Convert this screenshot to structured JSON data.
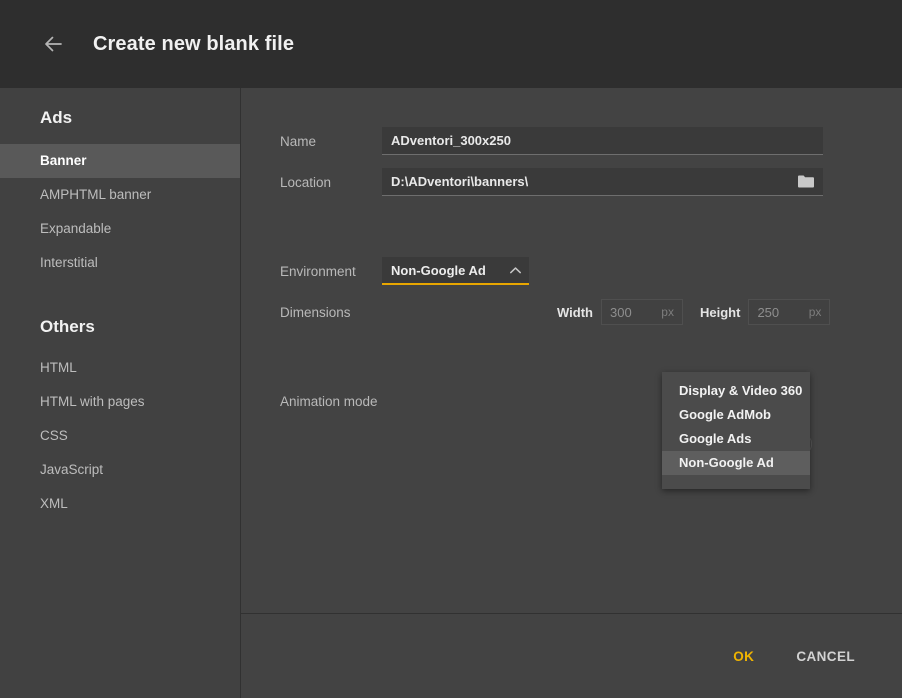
{
  "header": {
    "back_icon": "arrow-left-icon",
    "title": "Create new blank file"
  },
  "sidebar": {
    "groups": [
      {
        "title": "Ads",
        "items": [
          {
            "label": "Banner",
            "selected": true
          },
          {
            "label": "AMPHTML banner",
            "selected": false
          },
          {
            "label": "Expandable",
            "selected": false
          },
          {
            "label": "Interstitial",
            "selected": false
          }
        ]
      },
      {
        "title": "Others",
        "items": [
          {
            "label": "HTML",
            "selected": false
          },
          {
            "label": "HTML with pages",
            "selected": false
          },
          {
            "label": "CSS",
            "selected": false
          },
          {
            "label": "JavaScript",
            "selected": false
          },
          {
            "label": "XML",
            "selected": false
          }
        ]
      }
    ]
  },
  "form": {
    "name": {
      "label": "Name",
      "value": "ADventori_300x250"
    },
    "location": {
      "label": "Location",
      "value": "D:\\ADventori\\banners\\",
      "browse_icon": "folder-icon"
    },
    "environment": {
      "label": "Environment",
      "value": "Non-Google Ad",
      "caret_icon": "chevron-up-icon",
      "expanded": true,
      "options": [
        {
          "label": "Display & Video 360",
          "selected": false
        },
        {
          "label": "Google AdMob",
          "selected": false
        },
        {
          "label": "Google Ads",
          "selected": false
        },
        {
          "label": "Non-Google Ad",
          "selected": true
        }
      ]
    },
    "dimensions": {
      "label": "Dimensions",
      "width": {
        "label": "Width",
        "value": "300",
        "unit": "px"
      },
      "height": {
        "label": "Height",
        "value": "250",
        "unit": "px"
      }
    },
    "animation_mode": {
      "label": "Animation mode"
    }
  },
  "footer": {
    "ok_label": "OK",
    "cancel_label": "CANCEL"
  },
  "colors": {
    "accent": "#f0b400",
    "header_bg": "#2e2e2e",
    "panel_bg": "#434343",
    "sidebar_bg": "#414141",
    "selected_item_bg": "#595959",
    "menu_bg": "#4b4b4b"
  }
}
